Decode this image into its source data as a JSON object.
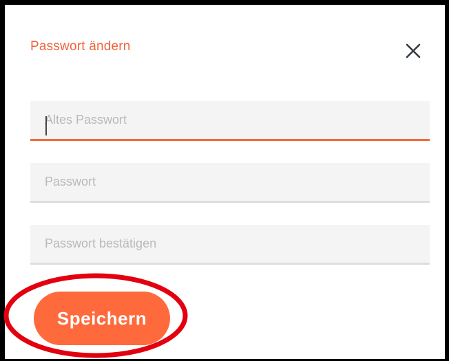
{
  "dialog": {
    "title": "Passwort ändern",
    "close_icon": "close-icon",
    "fields": [
      {
        "placeholder": "Altes Passwort",
        "value": "",
        "focused": true
      },
      {
        "placeholder": "Passwort",
        "value": "",
        "focused": false
      },
      {
        "placeholder": "Passwort bestätigen",
        "value": "",
        "focused": false
      }
    ],
    "save_label": "Speichern"
  },
  "colors": {
    "accent": "#ff6a3d",
    "title": "#f0643a",
    "field_bg": "#f4f4f4",
    "field_border": "#dedede",
    "highlight_ring": "#e3000f"
  }
}
